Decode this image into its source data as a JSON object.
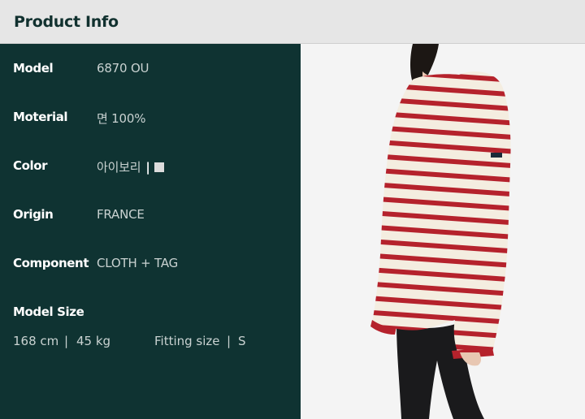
{
  "header": {
    "title": "Product Info"
  },
  "details": {
    "model_label": "Model",
    "model_value": "6870 OU",
    "material_label": "Moterial",
    "material_value": "면 100%",
    "color_label": "Color",
    "color_value": "아이보리",
    "color_separator": "|",
    "origin_label": "Origin",
    "origin_value": "FRANCE",
    "component_label": "Component",
    "component_value": "CLOTH + TAG"
  },
  "model_size": {
    "label": "Model Size",
    "height": "168 cm",
    "sep1": "|",
    "weight": "45 kg",
    "fitting_label": "Fitting size",
    "sep2": "|",
    "fitting_value": "S"
  },
  "colors": {
    "header_bg": "#e6e6e6",
    "panel_bg": "#0f3332",
    "stripe_red": "#b5222c",
    "stripe_ivory": "#f4ede0",
    "swatch": "#dcdcdc"
  }
}
